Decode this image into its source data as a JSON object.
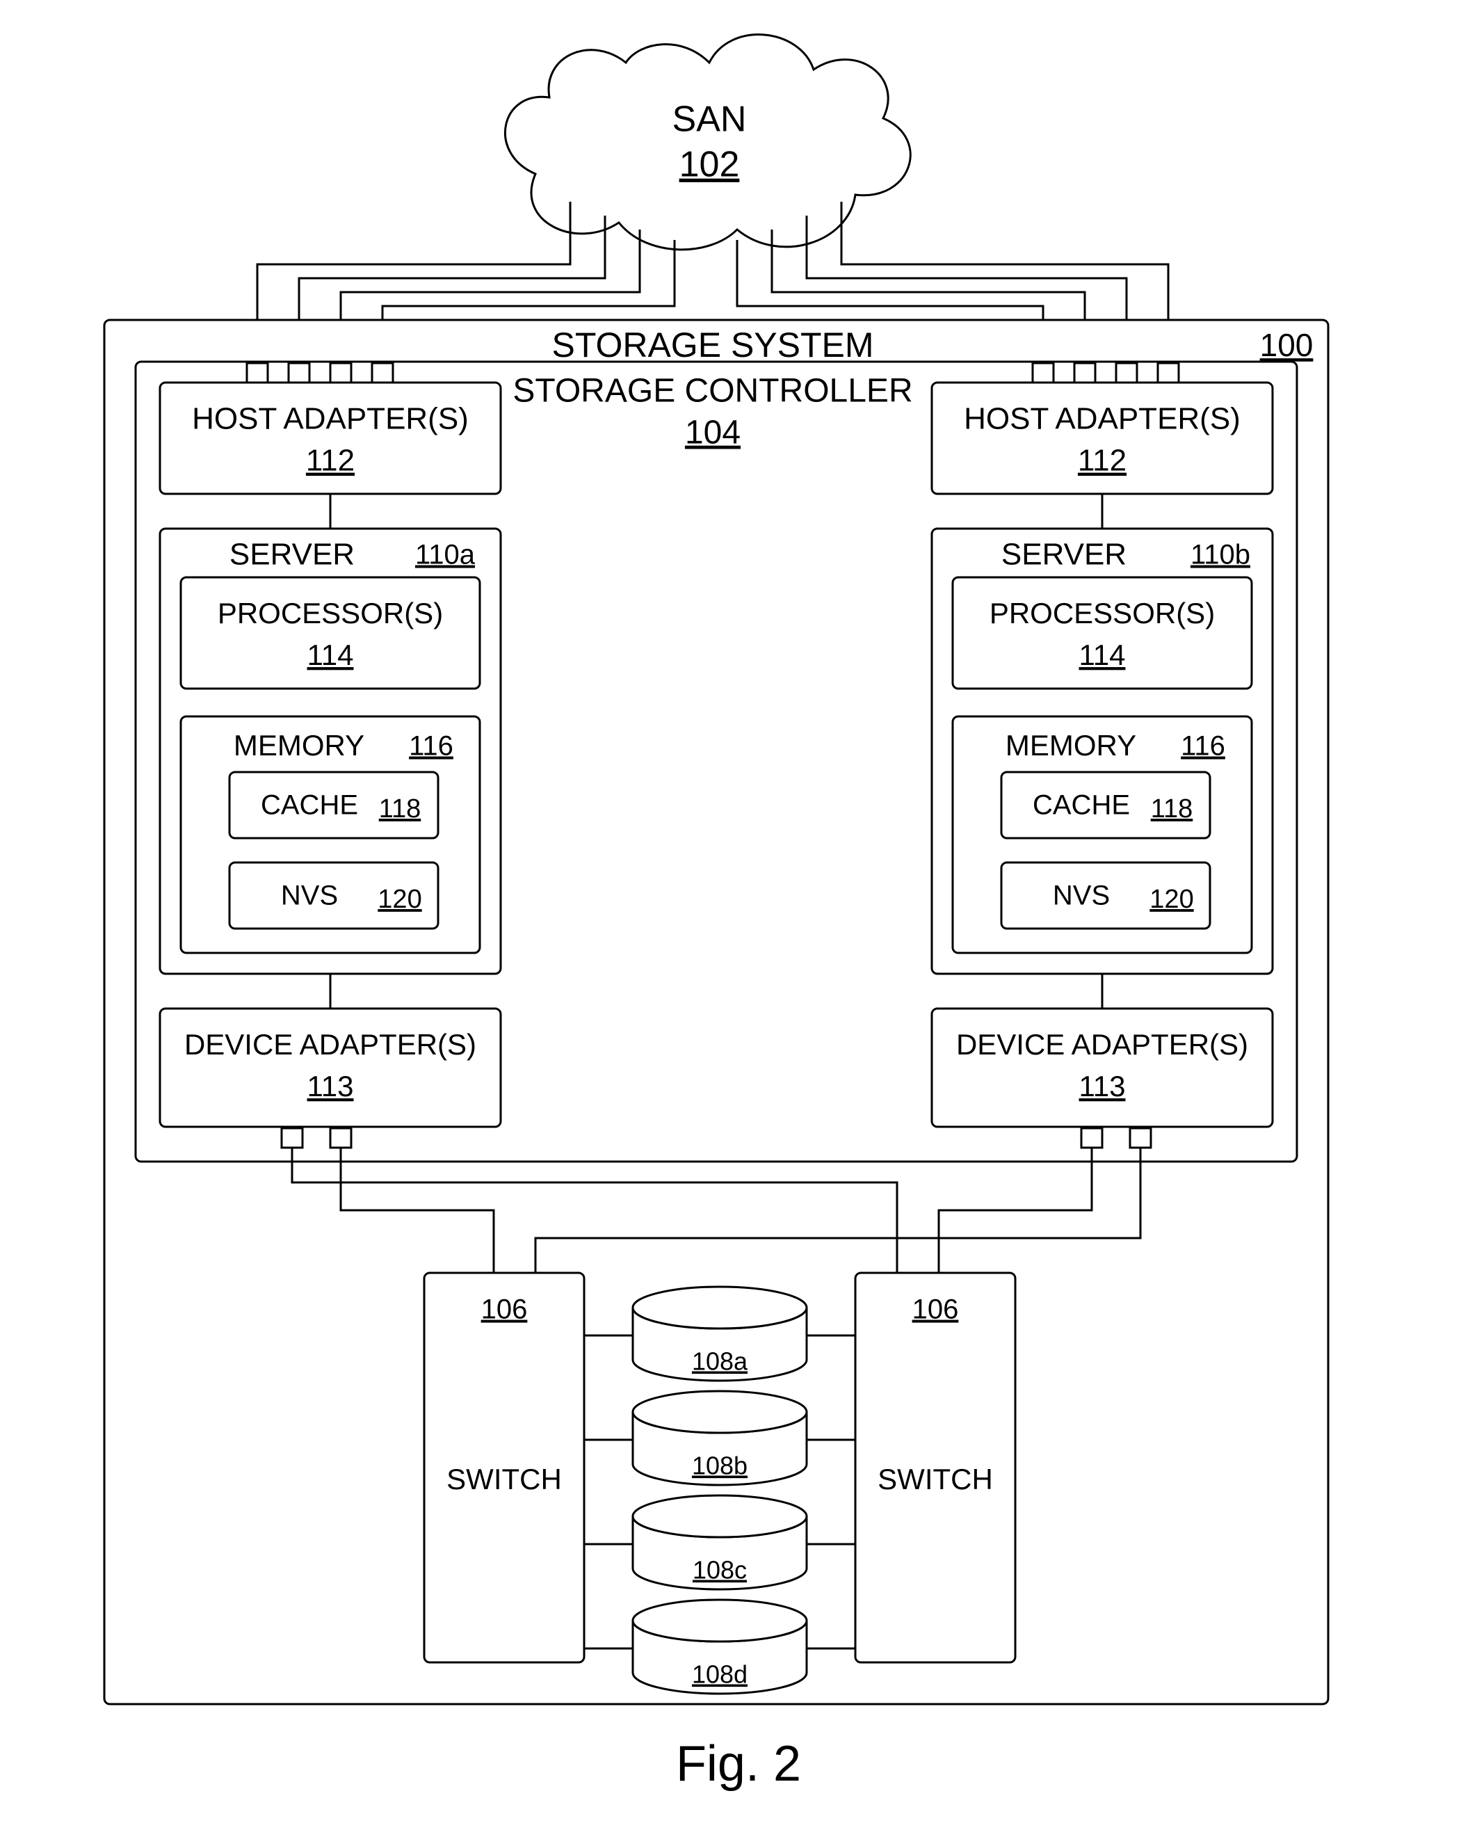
{
  "cloud": {
    "label": "SAN",
    "ref": "102"
  },
  "system": {
    "label": "STORAGE SYSTEM",
    "ref": "100"
  },
  "controller": {
    "label": "STORAGE CONTROLLER",
    "ref": "104"
  },
  "hostAdapterL": {
    "label": "HOST ADAPTER(S)",
    "ref": "112"
  },
  "hostAdapterR": {
    "label": "HOST ADAPTER(S)",
    "ref": "112"
  },
  "serverL": {
    "label": "SERVER",
    "ref": "110a"
  },
  "serverR": {
    "label": "SERVER",
    "ref": "110b"
  },
  "procL": {
    "label": "PROCESSOR(S)",
    "ref": "114"
  },
  "procR": {
    "label": "PROCESSOR(S)",
    "ref": "114"
  },
  "memL": {
    "label": "MEMORY",
    "ref": "116"
  },
  "memR": {
    "label": "MEMORY",
    "ref": "116"
  },
  "cacheL": {
    "label": "CACHE",
    "ref": "118"
  },
  "cacheR": {
    "label": "CACHE",
    "ref": "118"
  },
  "nvsL": {
    "label": "NVS",
    "ref": "120"
  },
  "nvsR": {
    "label": "NVS",
    "ref": "120"
  },
  "devAdpL": {
    "label": "DEVICE ADAPTER(S)",
    "ref": "113"
  },
  "devAdpR": {
    "label": "DEVICE ADAPTER(S)",
    "ref": "113"
  },
  "switchL": {
    "label": "SWITCH",
    "ref": "106"
  },
  "switchR": {
    "label": "SWITCH",
    "ref": "106"
  },
  "disks": [
    {
      "ref": "108a"
    },
    {
      "ref": "108b"
    },
    {
      "ref": "108c"
    },
    {
      "ref": "108d"
    }
  ],
  "figure": "Fig. 2"
}
